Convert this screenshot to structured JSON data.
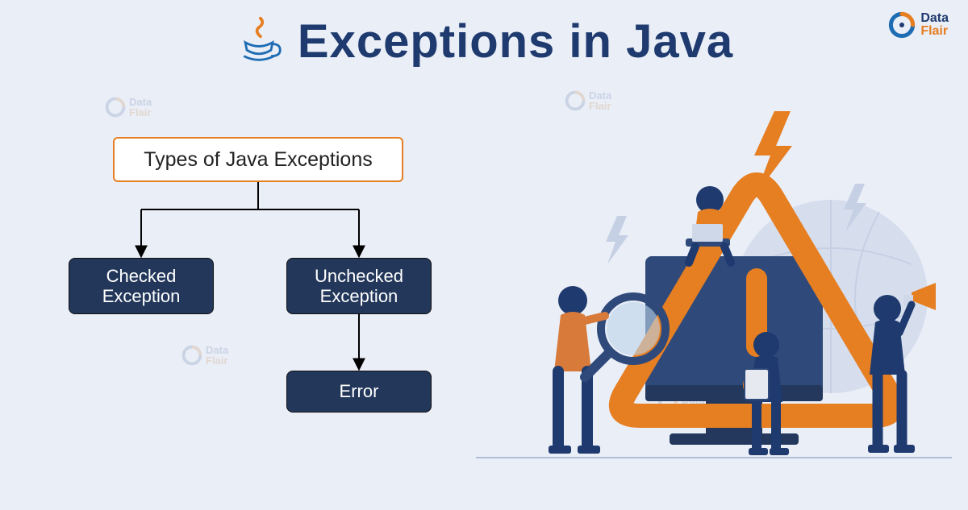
{
  "header": {
    "title": "Exceptions in Java",
    "icon_name": "java-cup-icon"
  },
  "brand": {
    "name_line1": "Data",
    "name_line2": "Flair"
  },
  "diagram": {
    "root": "Types of Java Exceptions",
    "checked": "Checked\nException",
    "unchecked": "Unchecked\nException",
    "error": "Error"
  },
  "colors": {
    "background": "#eaeef7",
    "title": "#1e3a6e",
    "accent": "#e67e22",
    "node_fill": "#22375a",
    "node_text": "#ffffff"
  }
}
